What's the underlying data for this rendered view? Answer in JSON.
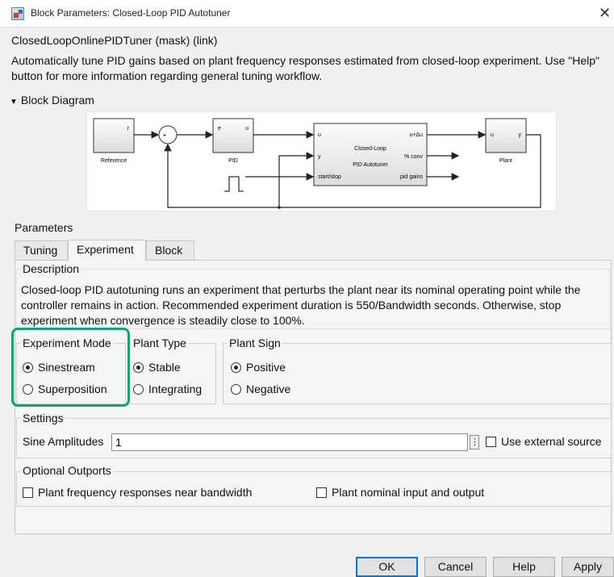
{
  "window": {
    "title": "Block Parameters: Closed-Loop PID Autotuner",
    "close_glyph": "✕"
  },
  "mask": {
    "title": "ClosedLoopOnlinePIDTuner (mask) (link)",
    "description": "Automatically tune PID gains based on plant frequency responses estimated from closed-loop experiment. Use \"Help\" button for more information regarding general tuning workflow."
  },
  "block_diagram": {
    "heading": "Block Diagram",
    "blocks": {
      "reference": {
        "label": "Reference",
        "port_out": "r"
      },
      "sum": {
        "plus": "+",
        "minus": "-"
      },
      "pid": {
        "label": "PID",
        "port_in": "e",
        "port_out": "u"
      },
      "autotuner": {
        "title_line1": "Closed-Loop",
        "title_line2": "PID Autotuner",
        "port_u": "u",
        "port_y": "y",
        "port_startstop": "start/stop",
        "port_u_delta": "u+Δu",
        "port_conv": "% conv",
        "port_gains": "pid gains"
      },
      "plant": {
        "label": "Plant",
        "port_in": "u",
        "port_out": "y"
      }
    }
  },
  "parameters": {
    "heading": "Parameters",
    "tabs": [
      {
        "label": "Tuning",
        "active": false
      },
      {
        "label": "Experiment",
        "active": true
      },
      {
        "label": "Block",
        "active": false
      }
    ],
    "description_title": "Description",
    "description_text": "Closed-loop PID autotuning runs an experiment that perturbs the plant near its nominal operating point while the controller remains in action.  Recommended experiment duration is 550/Bandwidth seconds.  Otherwise, stop experiment when convergence is steadily close to 100%.",
    "experiment_mode": {
      "title": "Experiment Mode",
      "options": [
        "Sinestream",
        "Superposition"
      ],
      "selected": "Sinestream"
    },
    "plant_type": {
      "title": "Plant Type",
      "options": [
        "Stable",
        "Integrating"
      ],
      "selected": "Stable"
    },
    "plant_sign": {
      "title": "Plant Sign",
      "options": [
        "Positive",
        "Negative"
      ],
      "selected": "Positive"
    },
    "settings": {
      "title": "Settings",
      "sine_amplitudes_label": "Sine Amplitudes",
      "sine_amplitudes_value": "1",
      "more_glyph": "⋮",
      "use_external_source_label": "Use external source",
      "use_external_source_checked": false
    },
    "optional_outports": {
      "title": "Optional Outports",
      "freq_resp_label": "Plant frequency responses near bandwidth",
      "freq_resp_checked": false,
      "nominal_io_label": "Plant nominal input and output",
      "nominal_io_checked": false
    }
  },
  "buttons": {
    "ok": "OK",
    "cancel": "Cancel",
    "help": "Help",
    "apply": "Apply"
  },
  "colors": {
    "highlight": "#13a07a",
    "default_button_border": "#0078d7"
  }
}
